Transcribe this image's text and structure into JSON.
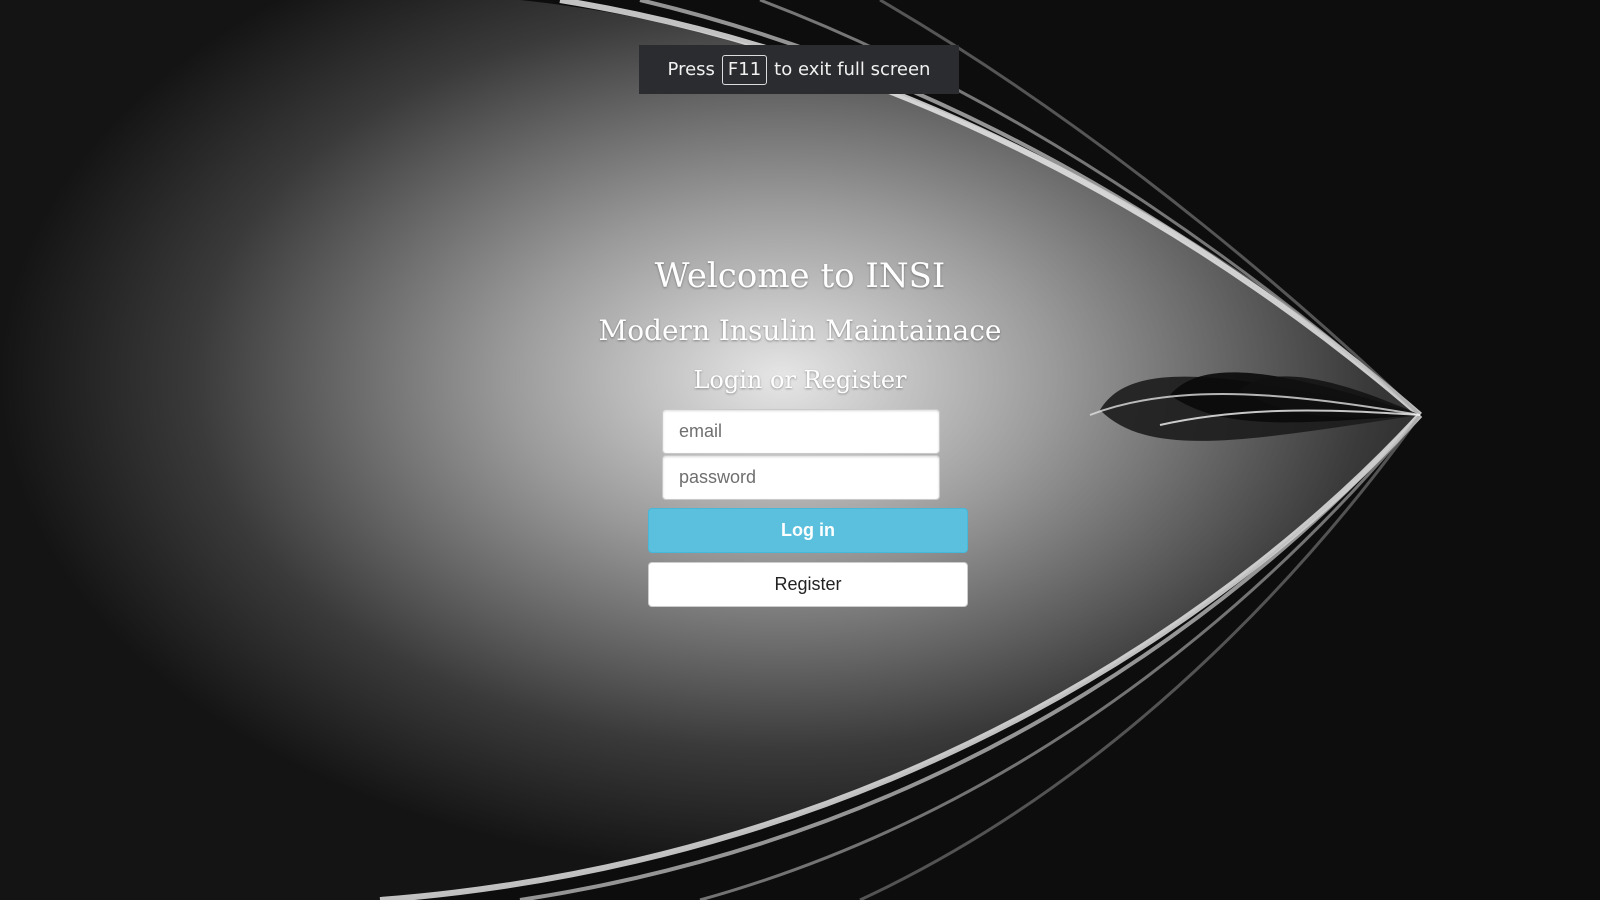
{
  "fullscreen_toast": {
    "before": "Press",
    "key": "F11",
    "after": "to exit full screen"
  },
  "login": {
    "welcome": "Welcome to INSI",
    "subtitle": "Modern Insulin Maintainace",
    "prompt": "Login or Register",
    "email_placeholder": "email",
    "password_placeholder": "password",
    "login_label": "Log in",
    "register_label": "Register"
  },
  "colors": {
    "login_button": "#5bc0de",
    "toast_background": "#2b2c2f",
    "page_background": "#0c0c0c"
  }
}
